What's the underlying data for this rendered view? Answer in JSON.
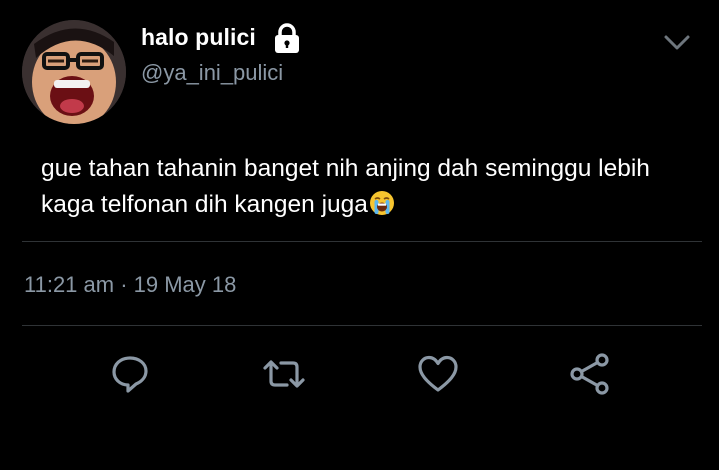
{
  "user": {
    "display_name": "halo pulici",
    "handle": "@ya_ini_pulici",
    "protected_icon": "lock-icon",
    "avatar_icon": "avatar-image"
  },
  "tweet": {
    "text": "gue tahan tahanin banget nih anjing dah seminggu lebih kaga telfonan dih kangen juga",
    "emoji": "loudly-crying-face",
    "timestamp": "11:21 am · 19 May 18"
  },
  "menu": {
    "icon": "chevron-down-icon"
  },
  "actions": [
    {
      "name": "reply",
      "icon": "reply-icon"
    },
    {
      "name": "retweet",
      "icon": "retweet-icon"
    },
    {
      "name": "like",
      "icon": "heart-icon"
    },
    {
      "name": "share",
      "icon": "share-icon"
    }
  ],
  "colors": {
    "background": "#000000",
    "primary_text": "#ffffff",
    "secondary_text": "#8b98a5",
    "divider": "#2f3336",
    "icon": "#8b98a5"
  }
}
